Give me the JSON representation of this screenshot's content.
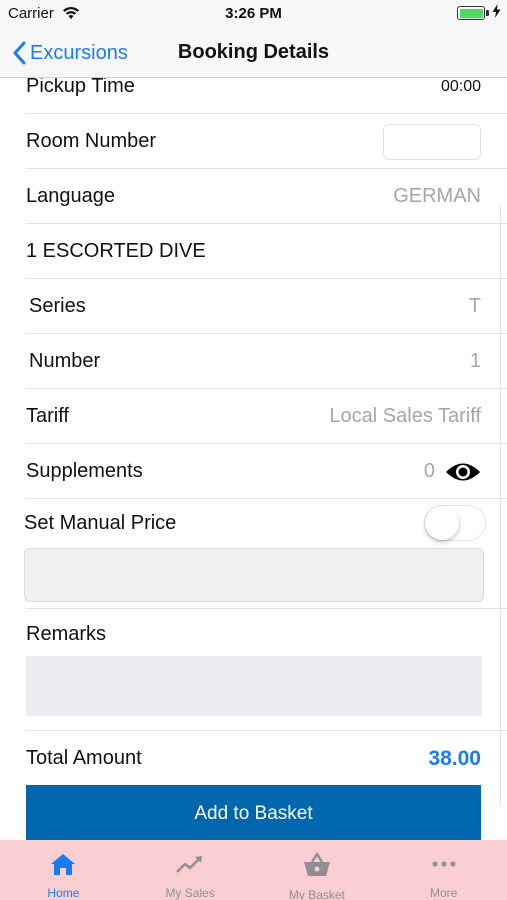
{
  "status_bar": {
    "carrier": "Carrier",
    "time": "3:26 PM"
  },
  "nav": {
    "back_label": "Excursions",
    "title": "Booking Details"
  },
  "rows": {
    "pickup_time": {
      "label": "Pickup Time",
      "value": "00:00"
    },
    "room_number": {
      "label": "Room Number",
      "value": ""
    },
    "language": {
      "label": "Language",
      "value": "GERMAN"
    },
    "excursion": {
      "label": "1 ESCORTED DIVE"
    },
    "series": {
      "label": "Series",
      "value": "T"
    },
    "number": {
      "label": "Number",
      "value": "1"
    },
    "tariff": {
      "label": "Tariff",
      "value": "Local Sales Tariff"
    },
    "supplements": {
      "label": "Supplements",
      "value": "0"
    },
    "manual_price": {
      "label": "Set Manual Price",
      "enabled": false,
      "value": ""
    },
    "remarks": {
      "label": "Remarks",
      "value": ""
    },
    "total": {
      "label": "Total Amount",
      "value": "38.00"
    }
  },
  "add_button_label": "Add to Basket",
  "tabs": [
    {
      "label": "Home",
      "icon": "home-icon",
      "active": true
    },
    {
      "label": "My Sales",
      "icon": "trend-icon",
      "active": false
    },
    {
      "label": "My Basket",
      "icon": "basket-icon",
      "active": false
    },
    {
      "label": "More",
      "icon": "more-icon",
      "active": false
    }
  ],
  "colors": {
    "accent": "#1a7cf5",
    "button": "#0066ad",
    "tab_bar": "#f9cfd2"
  }
}
